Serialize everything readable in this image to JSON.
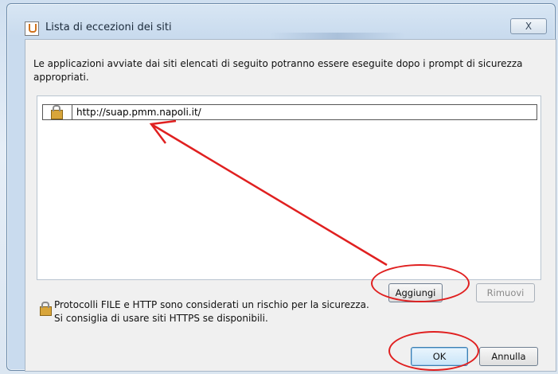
{
  "dialog": {
    "title": "Lista di eccezioni dei siti",
    "close_symbol": "X",
    "description": "Le applicazioni avviate dai siti elencati di seguito potranno essere eseguite dopo i prompt di sicurezza appropriati.",
    "sites": [
      {
        "url": "http://suap.pmm.napoli.it/",
        "icon": "unlocked-padlock-icon"
      }
    ],
    "add_button": "Aggiungi",
    "remove_button": "Rimuovi",
    "warning_lines": [
      "Protocolli FILE e HTTP sono considerati un rischio per la sicurezza.",
      "Si consiglia di usare siti HTTPS se disponibili."
    ],
    "ok_button": "OK",
    "cancel_button": "Annulla"
  },
  "annotations": {
    "color": "#e02020",
    "highlighted": [
      "add_button",
      "ok_button"
    ]
  }
}
